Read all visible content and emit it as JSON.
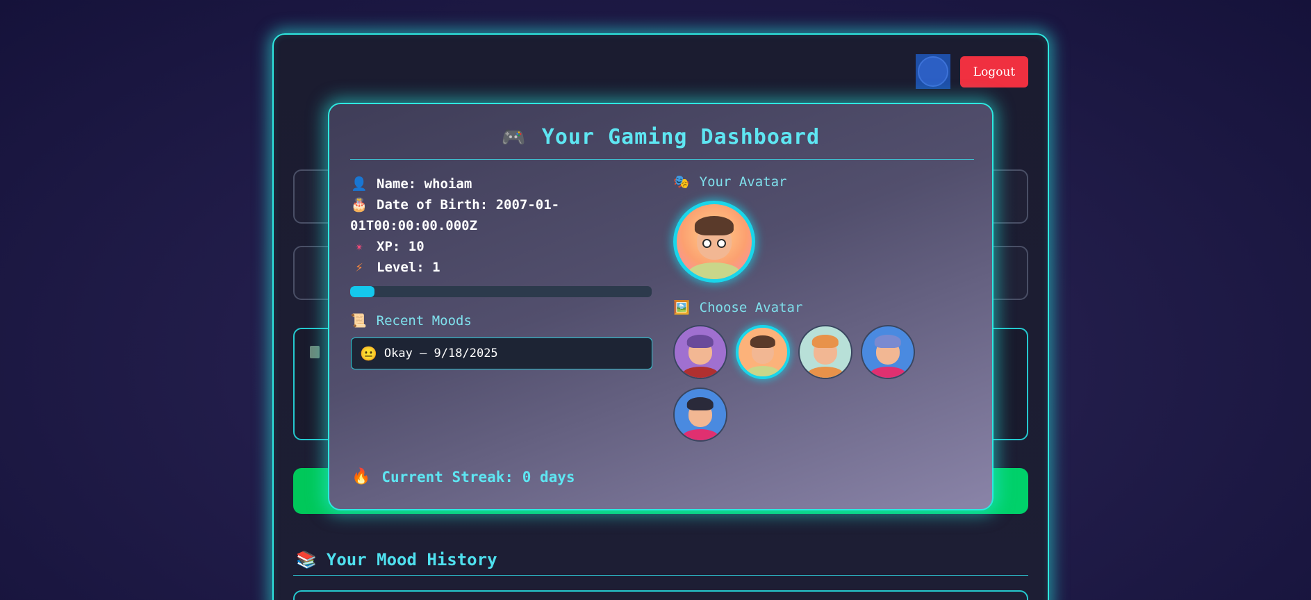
{
  "header": {
    "logout_label": "Logout"
  },
  "dashboard": {
    "title": "Your Gaming Dashboard",
    "title_icon": "gamepad-icon",
    "profile": {
      "name_label": "Name:",
      "name_value": "whoiam",
      "dob_label": "Date of Birth:",
      "dob_value_line1": "2007-01-",
      "dob_value_line2": "01T00:00:00.000Z",
      "xp_label": "XP:",
      "xp_value": "10",
      "level_label": "Level:",
      "level_value": "1",
      "xp_progress_fraction": 0.08
    },
    "recent_moods": {
      "title": "Recent Moods",
      "items": [
        {
          "mood": "Okay",
          "date": "9/18/2025",
          "text": "Okay — 9/18/2025",
          "icon": "neutral-face-icon"
        }
      ]
    },
    "your_avatar": {
      "title": "Your Avatar"
    },
    "choose_avatar": {
      "title": "Choose Avatar",
      "options": [
        {
          "name": "avatar-purple-hair",
          "bg": "#a070d0",
          "hair": "#6a4a9a",
          "shirt": "#b03030",
          "selected": false
        },
        {
          "name": "avatar-glasses-boy",
          "bg": "#fcb27a",
          "hair": "#5a3a2a",
          "shirt": "#c9d68a",
          "selected": true
        },
        {
          "name": "avatar-hijab-girl",
          "bg": "#b8e0d8",
          "hair": "#e8924a",
          "shirt": "#e8924a",
          "selected": false
        },
        {
          "name": "avatar-blue-hair",
          "bg": "#4a8ae0",
          "hair": "#7a8ad0",
          "shirt": "#e03070",
          "selected": false
        },
        {
          "name": "avatar-braids-girl",
          "bg": "#4a8ae0",
          "hair": "#2a2a3a",
          "shirt": "#e03070",
          "selected": false
        }
      ]
    },
    "streak": {
      "label": "Current Streak:",
      "value": "0 days",
      "text": "Current Streak: 0 days"
    }
  },
  "mood_history": {
    "title": "Your Mood History"
  },
  "colors": {
    "accent_cyan": "#2ee8e0",
    "logout_red": "#f03040",
    "submit_green": "#00c85a",
    "xp_fill": "#14c8ec"
  }
}
